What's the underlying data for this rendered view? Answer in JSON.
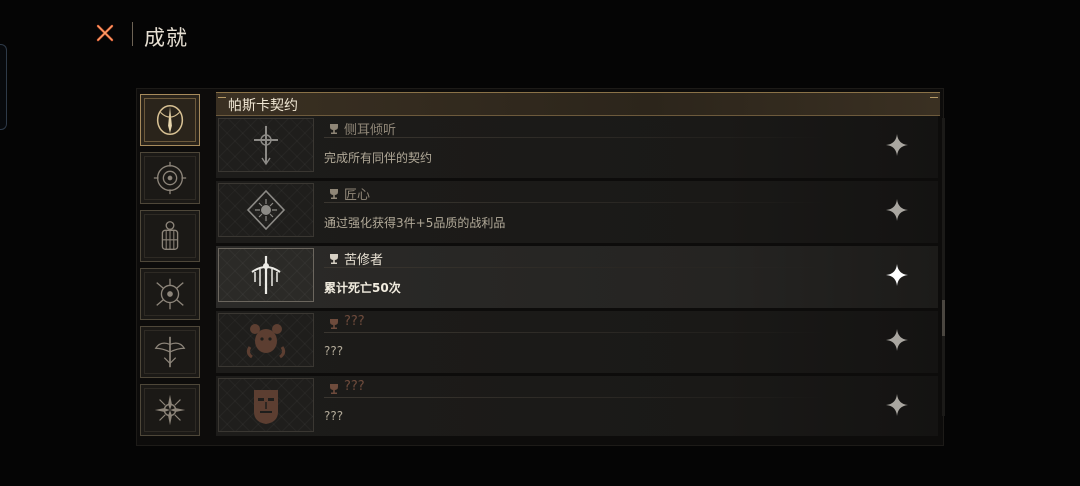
{
  "header": {
    "title": "成就"
  },
  "sidebar": {
    "categories": [
      {
        "icon": "pascal-pact-emblem-icon",
        "active": true
      },
      {
        "icon": "spiral-eye-emblem-icon"
      },
      {
        "icon": "cage-emblem-icon"
      },
      {
        "icon": "rose-eye-emblem-icon"
      },
      {
        "icon": "winged-blade-emblem-icon"
      },
      {
        "icon": "thorn-star-emblem-icon"
      }
    ]
  },
  "section": {
    "title": "帕斯卡契约"
  },
  "achievements": [
    {
      "name": "侧耳倾听",
      "description": "完成所有同伴的契约",
      "icon": "cross-sigil-icon",
      "unlocked": true
    },
    {
      "name": "匠心",
      "description": "通过强化获得3件+5品质的战利品",
      "icon": "diamond-sun-sigil-icon",
      "unlocked": true
    },
    {
      "name": "苦修者",
      "description": "累计死亡50次",
      "icon": "dripping-cross-sigil-icon",
      "unlocked": true,
      "highlighted": true
    },
    {
      "name": "???",
      "description": "???",
      "icon": "locked-bear-sigil-icon",
      "unlocked": false
    },
    {
      "name": "???",
      "description": "???",
      "icon": "locked-mask-sigil-icon",
      "unlocked": false
    }
  ],
  "colors": {
    "accent": "#a78b5c",
    "locked_icon": "#6a4a3a",
    "close": "#e2643a"
  }
}
